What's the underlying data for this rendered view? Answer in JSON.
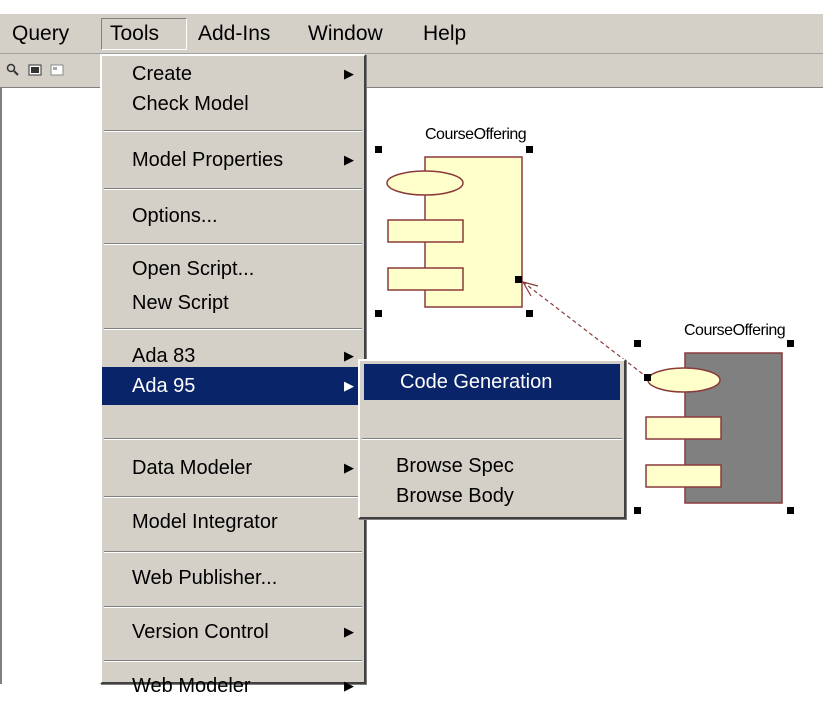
{
  "menubar": {
    "items": [
      "Query",
      "Tools",
      "Add-Ins",
      "Window",
      "Help"
    ]
  },
  "tools_menu": {
    "groups": [
      {
        "items": [
          {
            "label": "Create",
            "submenu": true
          },
          {
            "label": "Check Model",
            "submenu": false
          }
        ]
      },
      {
        "items": [
          {
            "label": "Model Properties",
            "submenu": true
          }
        ]
      },
      {
        "items": [
          {
            "label": "Options...",
            "submenu": false
          }
        ]
      },
      {
        "items": [
          {
            "label": "Open Script...",
            "submenu": false
          },
          {
            "label": "New Script",
            "submenu": false
          }
        ]
      },
      {
        "items": [
          {
            "label": "Ada 83",
            "submenu": true
          }
        ]
      },
      {
        "items": [
          {
            "label": "Ada 95",
            "submenu": true,
            "selected": true
          }
        ]
      },
      {
        "items": [
          {
            "label": "Data Modeler",
            "submenu": true
          }
        ]
      },
      {
        "items": [
          {
            "label": "Model Integrator",
            "submenu": false
          }
        ]
      },
      {
        "items": [
          {
            "label": "Web Publisher...",
            "submenu": false
          }
        ]
      },
      {
        "items": [
          {
            "label": "Version Control",
            "submenu": true
          }
        ]
      },
      {
        "items": [
          {
            "label": "Web Modeler",
            "submenu": true
          }
        ]
      }
    ]
  },
  "ada95_submenu": {
    "items": [
      "Code Generation",
      "Browse Spec",
      "Browse Body"
    ],
    "selected": "Code Generation"
  },
  "diagram": {
    "component_top_label": "CourseOffering",
    "component_bottom_label": "CourseOffering"
  },
  "colors": {
    "menu_bg": "#d4d0c8",
    "selection": "#0a246a",
    "component_light": "#ffffcc",
    "component_dark": "#808080",
    "dependency": "#8b3a3a"
  }
}
